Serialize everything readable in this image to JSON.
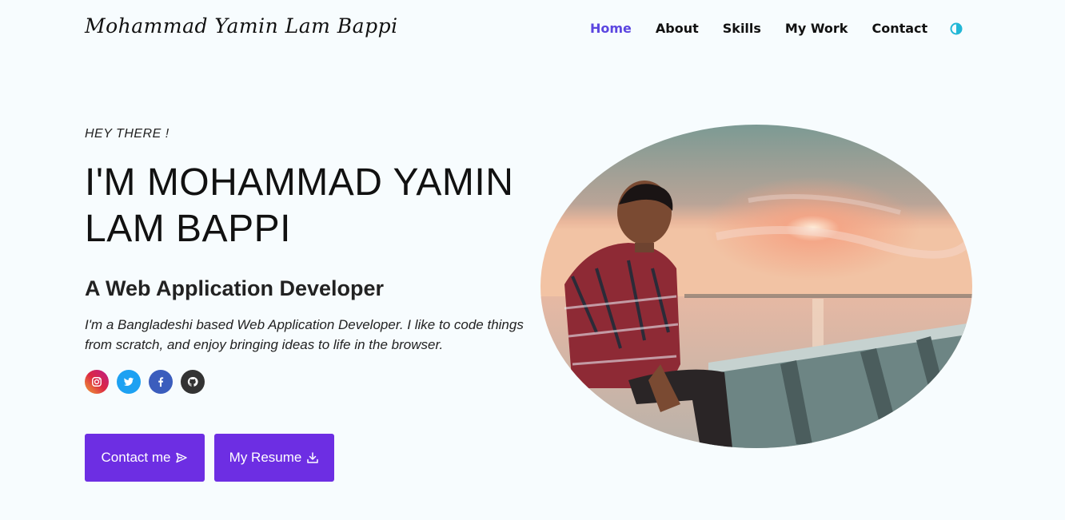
{
  "header": {
    "logo": "Mohammad Yamin Lam Bappi",
    "nav": [
      {
        "label": "Home",
        "active": true
      },
      {
        "label": "About",
        "active": false
      },
      {
        "label": "Skills",
        "active": false
      },
      {
        "label": "My Work",
        "active": false
      },
      {
        "label": "Contact",
        "active": false
      }
    ],
    "theme_toggle_icon": "half-circle-icon"
  },
  "hero": {
    "greeting": "HEY THERE !",
    "name": "I'M MOHAMMAD YAMIN LAM BAPPI",
    "role": "A Web Application Developer",
    "bio": "I'm a Bangladeshi based Web Application Developer. I like to code things from scratch, and enjoy bringing ideas to life in the browser.",
    "socials": [
      {
        "icon": "instagram-icon"
      },
      {
        "icon": "twitter-icon"
      },
      {
        "icon": "facebook-icon"
      },
      {
        "icon": "github-icon"
      }
    ],
    "contact_button": "Contact me",
    "resume_button": "My Resume",
    "photo_icon": "profile-photo"
  },
  "colors": {
    "accent": "#6d2ee3",
    "nav_active": "#5b46e0",
    "background": "#f7fcfe",
    "toggle": "#22b7d6"
  }
}
